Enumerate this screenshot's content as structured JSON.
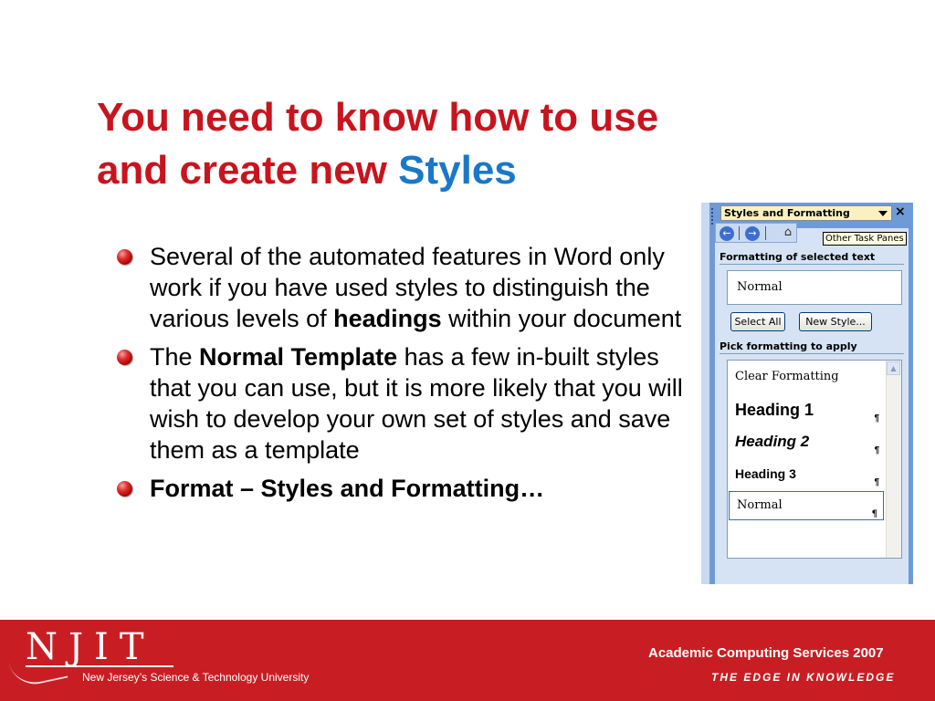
{
  "slide": {
    "title_line1": "You need to know how to use",
    "title_line2_prefix": "and create new ",
    "title_line2_accent": "Styles",
    "bullets": [
      {
        "parts": [
          "Several of the automated features in Word only work if you have used styles to distinguish the various levels of ",
          "headings",
          " within your document"
        ]
      },
      {
        "parts": [
          "The ",
          "Normal Template",
          " has a few in-built styles that you can use, but it is more likely that you will wish to develop your own set of styles and save them as a template"
        ]
      },
      {
        "parts": [
          "Format – Styles and Formatting…"
        ]
      }
    ],
    "colors": {
      "title": "#c8141e",
      "accent": "#1a78c8",
      "footer": "#c81e23"
    }
  },
  "pane": {
    "header": "Styles and Formatting",
    "close": "×",
    "nav": {
      "back_icon": "back-arrow-icon",
      "forward_icon": "forward-arrow-icon",
      "home_icon": "home-icon"
    },
    "tooltip": "Other Task Panes",
    "section1_label": "Formatting of selected text",
    "selected_style": "Normal",
    "select_all_label": "Select All",
    "new_style_label": "New Style...",
    "section2_label": "Pick formatting to apply",
    "styles": {
      "clear": "Clear Formatting",
      "heading1": "Heading 1",
      "heading2": "Heading 2",
      "heading3": "Heading 3",
      "normal": "Normal"
    },
    "para_mark": "¶"
  },
  "footer": {
    "logo": "NJIT",
    "university": "New Jersey’s Science & Technology University",
    "dept": "Academic Computing Services 2007",
    "tagline": "THE EDGE IN KNOWLEDGE"
  }
}
